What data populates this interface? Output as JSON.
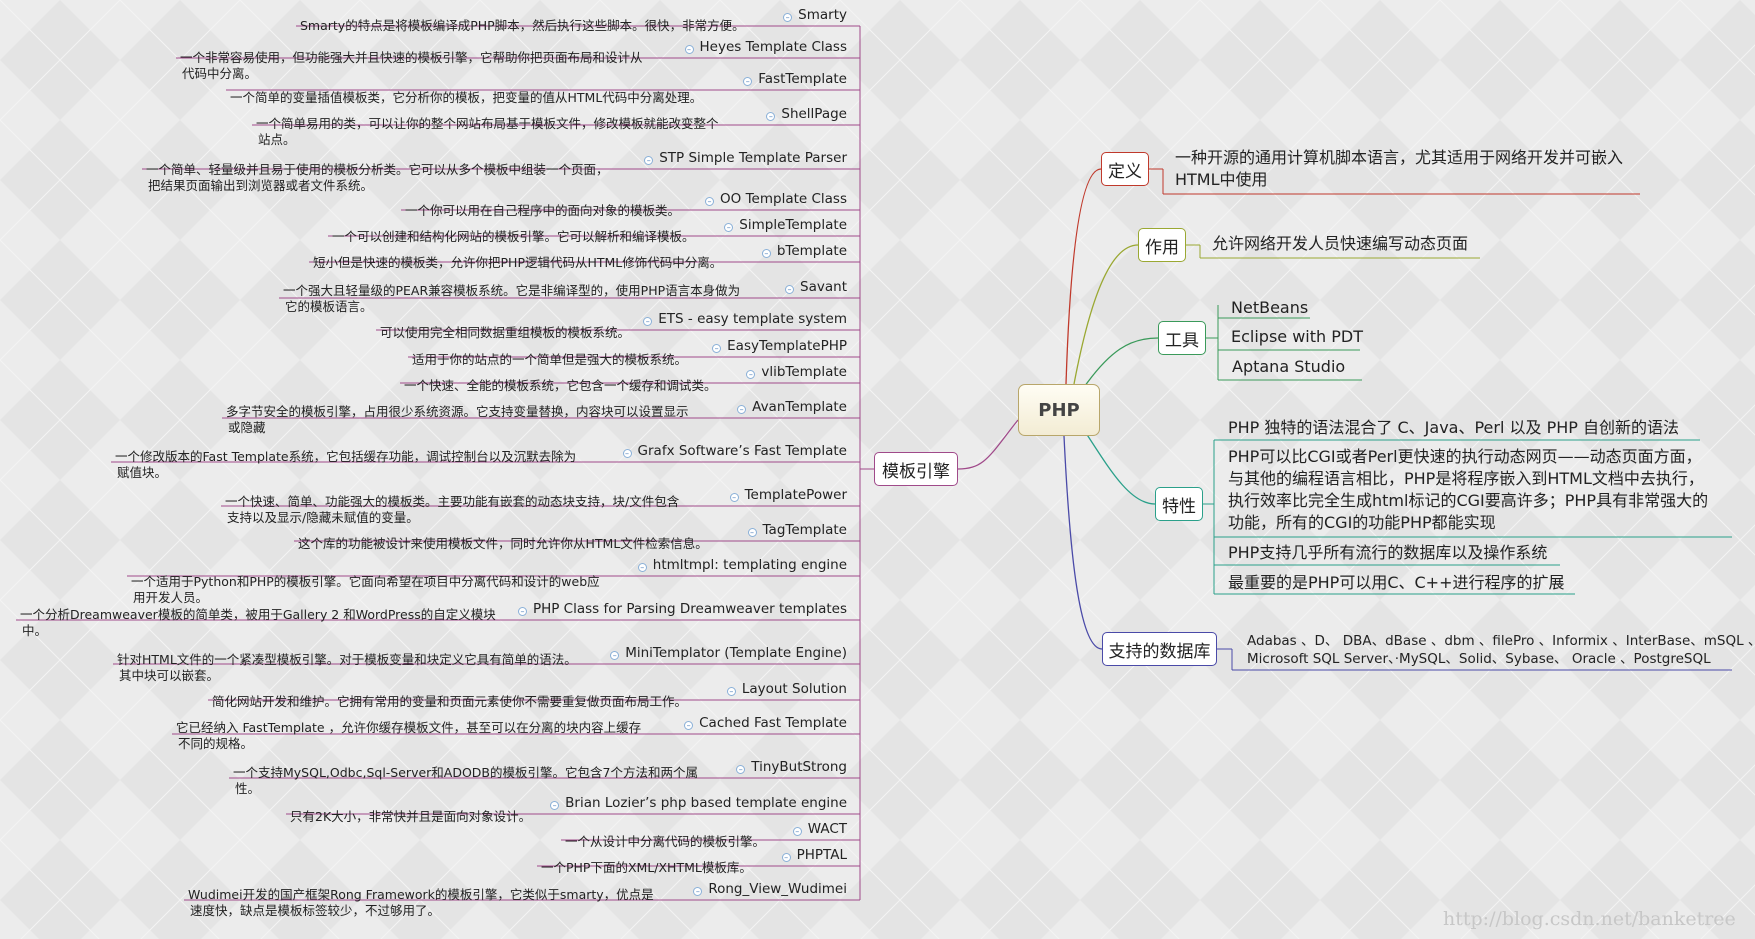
{
  "root": "PHP",
  "branches": {
    "definition": {
      "label": "定义",
      "text": [
        "一种开源的通用计算机脚本语言，尤其适用于网络开发并可嵌入",
        "HTML中使用"
      ],
      "color": "#c0392b"
    },
    "purpose": {
      "label": "作用",
      "text": "允许网络开发人员快速编写动态页面",
      "color": "#9aa832"
    },
    "tools": {
      "label": "工具",
      "items": [
        "NetBeans",
        "Eclipse with PDT",
        "Aptana Studio"
      ],
      "color": "#3a9a5a"
    },
    "features": {
      "label": "特性",
      "color": "#2aa08a",
      "items": [
        [
          "PHP 独特的语法混合了 C、Java、Perl 以及 PHP 自创新的语法"
        ],
        [
          "PHP可以比CGI或者Perl更快速的执行动态网页——动态页面方面，",
          "与其他的编程语言相比，PHP是将程序嵌入到HTML文档中去执行，",
          "执行效率比完全生成html标记的CGI要高许多；PHP具有非常强大的",
          "功能，所有的CGI的功能PHP都能实现"
        ],
        [
          "PHP支持几乎所有流行的数据库以及操作系统"
        ],
        [
          "最重要的是PHP可以用C、C++进行程序的扩展"
        ]
      ]
    },
    "databases": {
      "label": "支持的数据库",
      "color": "#4a4aa8",
      "text": [
        "Adabas 、D、 DBA、dBase 、dbm 、filePro 、Informix 、InterBase、mSQL 、",
        "Microsoft SQL Server、·MySQL、Solid、Sybase、 Oracle 、PostgreSQL"
      ]
    },
    "template_engines": {
      "label": "模板引擎",
      "color": "#a04a8a",
      "items": [
        {
          "name": "Smarty",
          "desc": [
            "Smarty的特点是将模板编译成PHP脚本，然后执行这些脚本。很快，非常方便。"
          ]
        },
        {
          "name": "Heyes Template Class",
          "desc": [
            "一个非常容易使用，但功能强大并且快速的模板引擎，它帮助你把页面布局和设计从",
            "代码中分离。"
          ]
        },
        {
          "name": "FastTemplate",
          "desc": [
            "一个简单的变量插值模板类，它分析你的模板，把变量的值从HTML代码中分离处理。"
          ]
        },
        {
          "name": "ShellPage",
          "desc": [
            "一个简单易用的类，可以让你的整个网站布局基于模板文件，修改模板就能改变整个",
            "站点。"
          ]
        },
        {
          "name": "STP Simple Template Parser",
          "desc": [
            "一个简单、轻量级并且易于使用的模板分析类。它可以从多个模板中组装一个页面，",
            "把结果页面输出到浏览器或者文件系统。"
          ]
        },
        {
          "name": "OO Template Class",
          "desc": [
            "一个你可以用在自己程序中的面向对象的模板类。"
          ]
        },
        {
          "name": "SimpleTemplate",
          "desc": [
            "一个可以创建和结构化网站的模板引擎。它可以解析和编译模板。"
          ]
        },
        {
          "name": "bTemplate",
          "desc": [
            "短小但是快速的模板类，允许你把PHP逻辑代码从HTML修饰代码中分离。"
          ]
        },
        {
          "name": "Savant",
          "desc": [
            "一个强大且轻量级的PEAR兼容模板系统。它是非编译型的，使用PHP语言本身做为",
            "它的模板语言。"
          ]
        },
        {
          "name": "ETS - easy template system",
          "desc": [
            "可以使用完全相同数据重组模板的模板系统。"
          ]
        },
        {
          "name": "EasyTemplatePHP",
          "desc": [
            "适用于你的站点的一个简单但是强大的模板系统。"
          ]
        },
        {
          "name": "vlibTemplate",
          "desc": [
            "一个快速、全能的模板系统，它包含一个缓存和调试类。"
          ]
        },
        {
          "name": "AvanTemplate",
          "desc": [
            "多字节安全的模板引擎，占用很少系统资源。它支持变量替换，内容块可以设置显示",
            "或隐藏"
          ]
        },
        {
          "name": "Grafx Software’s Fast Template",
          "desc": [
            "一个修改版本的Fast Template系统，它包括缓存功能，调试控制台以及沉默去除为",
            "赋值块。"
          ]
        },
        {
          "name": "TemplatePower",
          "desc": [
            "一个快速、简单、功能强大的模板类。主要功能有嵌套的动态块支持，块/文件包含",
            "支持以及显示/隐藏未赋值的变量。"
          ]
        },
        {
          "name": "TagTemplate",
          "desc": [
            "这个库的功能被设计来使用模板文件，同时允许你从HTML文件检索信息。"
          ]
        },
        {
          "name": "htmltmpl: templating engine",
          "desc": [
            "一个适用于Python和PHP的模板引擎。它面向希望在项目中分离代码和设计的web应",
            "用开发人员。"
          ]
        },
        {
          "name": "PHP Class for Parsing Dreamweaver templates",
          "desc": [
            "一个分析Dreamweaver模板的简单类，被用于Gallery 2 和WordPress的自定义模块",
            "中。"
          ]
        },
        {
          "name": "MiniTemplator (Template Engine)",
          "desc": [
            "针对HTML文件的一个紧凑型模板引擎。对于模板变量和块定义它具有简单的语法。",
            "其中块可以嵌套。"
          ]
        },
        {
          "name": "Layout Solution",
          "desc": [
            "简化网站开发和维护。它拥有常用的变量和页面元素使你不需要重复做页面布局工作。"
          ]
        },
        {
          "name": "Cached Fast Template",
          "desc": [
            "它已经纳入 FastTemplate ，允许你缓存模板文件，甚至可以在分离的块内容上缓存",
            "不同的规格。"
          ]
        },
        {
          "name": "TinyButStrong",
          "desc": [
            "一个支持MySQL,Odbc,Sql-Server和ADODB的模板引擎。它包含7个方法和两个属",
            "性。"
          ]
        },
        {
          "name": "Brian Lozier’s php based template engine",
          "desc": [
            "只有2K大小，非常快并且是面向对象设计。"
          ]
        },
        {
          "name": "WACT",
          "desc": [
            "一个从设计中分离代码的模板引擎。"
          ]
        },
        {
          "name": "PHPTAL",
          "desc": [
            "一个PHP下面的XML/XHTML模板库。"
          ]
        },
        {
          "name": "Rong_View_Wudimei",
          "desc": [
            "Wudimei开发的国产框架Rong Framework的模板引擎，它类似于smarty，优点是",
            "速度快，缺点是模板标签较少，不过够用了。"
          ]
        }
      ]
    }
  },
  "watermark": "http://blog.csdn.net/banketree"
}
